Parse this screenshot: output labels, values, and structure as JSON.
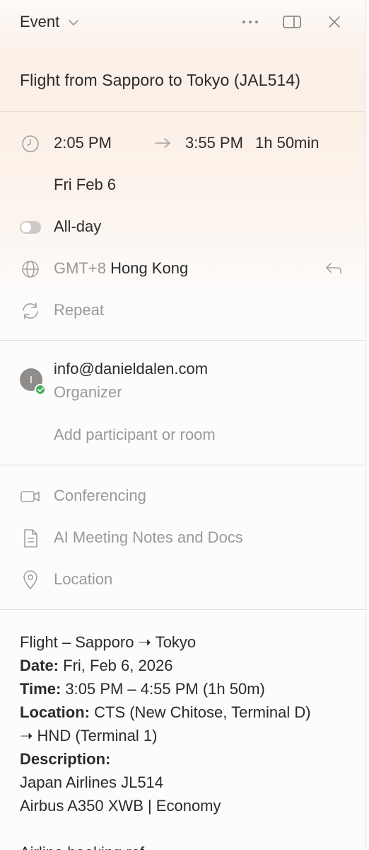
{
  "header": {
    "title": "Event",
    "icons": [
      "chevron-down-icon",
      "more-icon",
      "sidebar-icon",
      "close-icon"
    ]
  },
  "event": {
    "title": "Flight from Sapporo to Tokyo (JAL514)"
  },
  "time": {
    "start": "2:05 PM",
    "end": "3:55 PM",
    "duration": "1h 50min",
    "date": "Fri Feb 6"
  },
  "allday": {
    "label": "All-day",
    "enabled": false
  },
  "timezone": {
    "offset": "GMT+8",
    "name": "Hong Kong"
  },
  "repeat": {
    "label": "Repeat"
  },
  "organizer": {
    "initial": "I",
    "email": "info@danieldalen.com",
    "role": "Organizer"
  },
  "participants": {
    "placeholder": "Add participant or room"
  },
  "options": {
    "conferencing": "Conferencing",
    "notes": "AI Meeting Notes and Docs",
    "location": "Location"
  },
  "description": {
    "line1": "Flight – Sapporo ➝ Tokyo",
    "date_label": "Date:",
    "date_value": " Fri, Feb 6, 2026",
    "time_label": "Time:",
    "time_value": " 3:05 PM – 4:55 PM (1h 50m)",
    "location_label": "Location:",
    "location_value": " CTS (New Chitose, Terminal D)",
    "location_value2": "➝ HND (Terminal 1)",
    "description_label": "Description:",
    "airline": "Japan Airlines JL514",
    "aircraft": "Airbus A350 XWB | Economy",
    "cut_line": "Airline booking ref"
  },
  "colors": {
    "accent_badge": "#3fae58",
    "muted_text": "#9b9898",
    "primary_text": "#2b2b2b"
  }
}
